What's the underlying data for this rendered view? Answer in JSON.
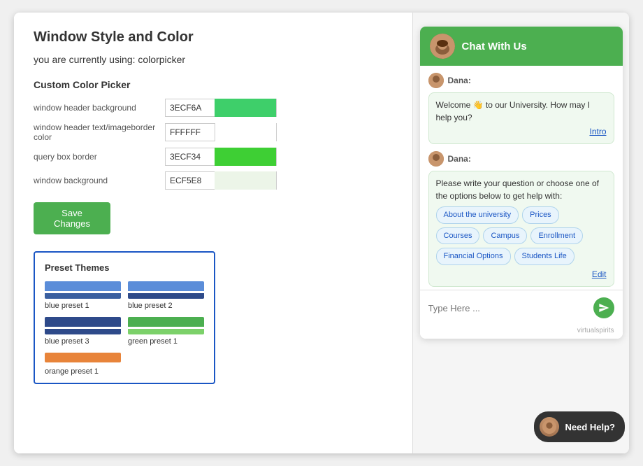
{
  "page": {
    "title": "Window Style and Color",
    "current_using_label": "you are currently using: colorpicker"
  },
  "color_picker": {
    "section_title": "Custom Color Picker",
    "fields": [
      {
        "label": "window header background",
        "value": "3ECF6A",
        "swatch": "#3ECF6A"
      },
      {
        "label": "window header text/imageborder color",
        "value": "FFFFFF",
        "swatch": "#FFFFFF"
      },
      {
        "label": "query box border",
        "value": "3ECF34",
        "swatch": "#3ECF34"
      },
      {
        "label": "window background",
        "value": "ECF5E8",
        "swatch": "#ECF5E8"
      }
    ],
    "save_button": "Save Changes"
  },
  "preset_themes": {
    "title": "Preset Themes",
    "items": [
      {
        "label": "blue preset 1",
        "top_color": "#5b8dd9",
        "bottom_color": "#3a5fa0"
      },
      {
        "label": "blue preset 2",
        "top_color": "#5b8dd9",
        "bottom_color": "#2e4a8a"
      },
      {
        "label": "blue preset 3",
        "top_color": "#2e4a8a",
        "bottom_color": "#2e4a8a"
      },
      {
        "label": "green preset 1",
        "top_color": "#4CAF50",
        "bottom_color": "#7cd16a"
      },
      {
        "label": "orange preset 1",
        "top_color": "#e8843a",
        "bottom_color": null
      }
    ]
  },
  "chat": {
    "header_title": "Chat With Us",
    "agent_name": "Dana",
    "messages": [
      {
        "sender": "Dana",
        "text": "Welcome 👋 to our University. How may I help you?",
        "link": "Intro"
      },
      {
        "sender": "Dana",
        "text": "Please write your question or choose one of the options below to get help with:",
        "chips": [
          "About the university",
          "Prices",
          "Courses",
          "Campus",
          "Enrollment",
          "Financial Options",
          "Students Life"
        ],
        "edit_link": "Edit"
      }
    ],
    "input_placeholder": "Type Here ...",
    "branding": "virtualspirits",
    "need_help_button": "Need Help?"
  }
}
